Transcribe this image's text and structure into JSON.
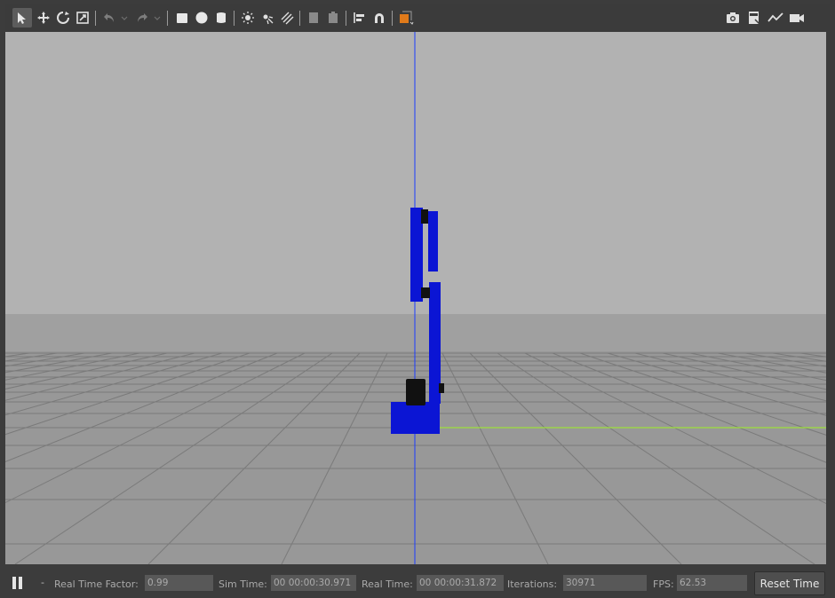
{
  "toolbar": {
    "left_tools": [
      {
        "name": "select-mode",
        "icon": "arrow-cursor-icon",
        "active": true
      },
      {
        "name": "translate-mode",
        "icon": "move-cross-icon"
      },
      {
        "name": "rotate-mode",
        "icon": "rotate-icon"
      },
      {
        "name": "scale-mode",
        "icon": "scale-icon"
      },
      {
        "name": "undo",
        "icon": "undo-icon"
      },
      {
        "name": "redo",
        "icon": "redo-icon"
      },
      {
        "name": "box-shape",
        "icon": "box-icon"
      },
      {
        "name": "sphere-shape",
        "icon": "sphere-icon"
      },
      {
        "name": "cylinder-shape",
        "icon": "cylinder-icon"
      },
      {
        "name": "point-light",
        "icon": "sun-icon"
      },
      {
        "name": "spot-light",
        "icon": "spotlight-icon"
      },
      {
        "name": "directional-light",
        "icon": "directional-light-icon"
      },
      {
        "name": "copy",
        "icon": "copy-icon"
      },
      {
        "name": "paste",
        "icon": "paste-icon"
      },
      {
        "name": "align",
        "icon": "align-icon"
      },
      {
        "name": "snap",
        "icon": "magnet-icon"
      },
      {
        "name": "view-angle",
        "icon": "view-angle-icon"
      }
    ],
    "right_tools": [
      {
        "name": "screenshot",
        "icon": "camera-icon"
      },
      {
        "name": "log",
        "icon": "log-icon",
        "text": "LOG"
      },
      {
        "name": "plot",
        "icon": "plot-icon"
      },
      {
        "name": "record-video",
        "icon": "video-icon"
      }
    ]
  },
  "bottom_bar": {
    "pause_icon": "pause-icon",
    "step_indicator": "-",
    "real_time_factor_label": "Real Time Factor:",
    "real_time_factor_value": "0.99",
    "sim_time_label": "Sim Time:",
    "sim_time_value": "00 00:00:30.971",
    "real_time_label": "Real Time:",
    "real_time_value": "00 00:00:31.872",
    "iterations_label": "Iterations:",
    "iterations_value": "30971",
    "fps_label": "FPS:",
    "fps_value": "62.53",
    "reset_time_label": "Reset Time"
  },
  "colors": {
    "sky": "#b2b2b2",
    "ground": "#979797",
    "robot": "#0b15d4",
    "joint": "#000000",
    "z_axis": "#1a3cff",
    "y_axis": "#9de03c",
    "accent_orange": "#e07a1a"
  }
}
